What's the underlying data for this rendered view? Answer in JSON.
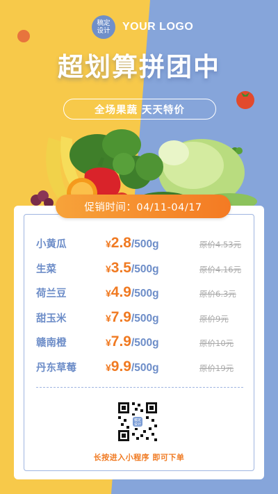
{
  "header": {
    "logo_badge_line1": "稿定",
    "logo_badge_line2": "设计",
    "logo_text": "YOUR LOGO"
  },
  "title": "超划算拼团中",
  "subtitle": "全场果蔬 天天特价",
  "promo": {
    "label": "促销时间：04/11-04/17"
  },
  "currency_symbol": "¥",
  "items": [
    {
      "name": "小黄瓜",
      "price": "2.8",
      "unit": "/500g",
      "original": "原价4.53元"
    },
    {
      "name": "生菜",
      "price": "3.5",
      "unit": "/500g",
      "original": "原价4.16元"
    },
    {
      "name": "荷兰豆",
      "price": "4.9",
      "unit": "/500g",
      "original": "原价6.3元"
    },
    {
      "name": "甜玉米",
      "price": "7.9",
      "unit": "/500g",
      "original": "原价9元"
    },
    {
      "name": "赣南橙",
      "price": "7.9",
      "unit": "/500g",
      "original": "原价10元"
    },
    {
      "name": "丹东草莓",
      "price": "9.9",
      "unit": "/500g",
      "original": "原价19元"
    }
  ],
  "qr": {
    "center_line1": "稿定",
    "center_line2": "设计"
  },
  "cta": "长按进入小程序 即可下单",
  "colors": {
    "yellow_bg": "#f7c94a",
    "blue_bg": "#7d9ed6",
    "accent_orange": "#f07a22",
    "text_blue": "#6d8dc8"
  }
}
